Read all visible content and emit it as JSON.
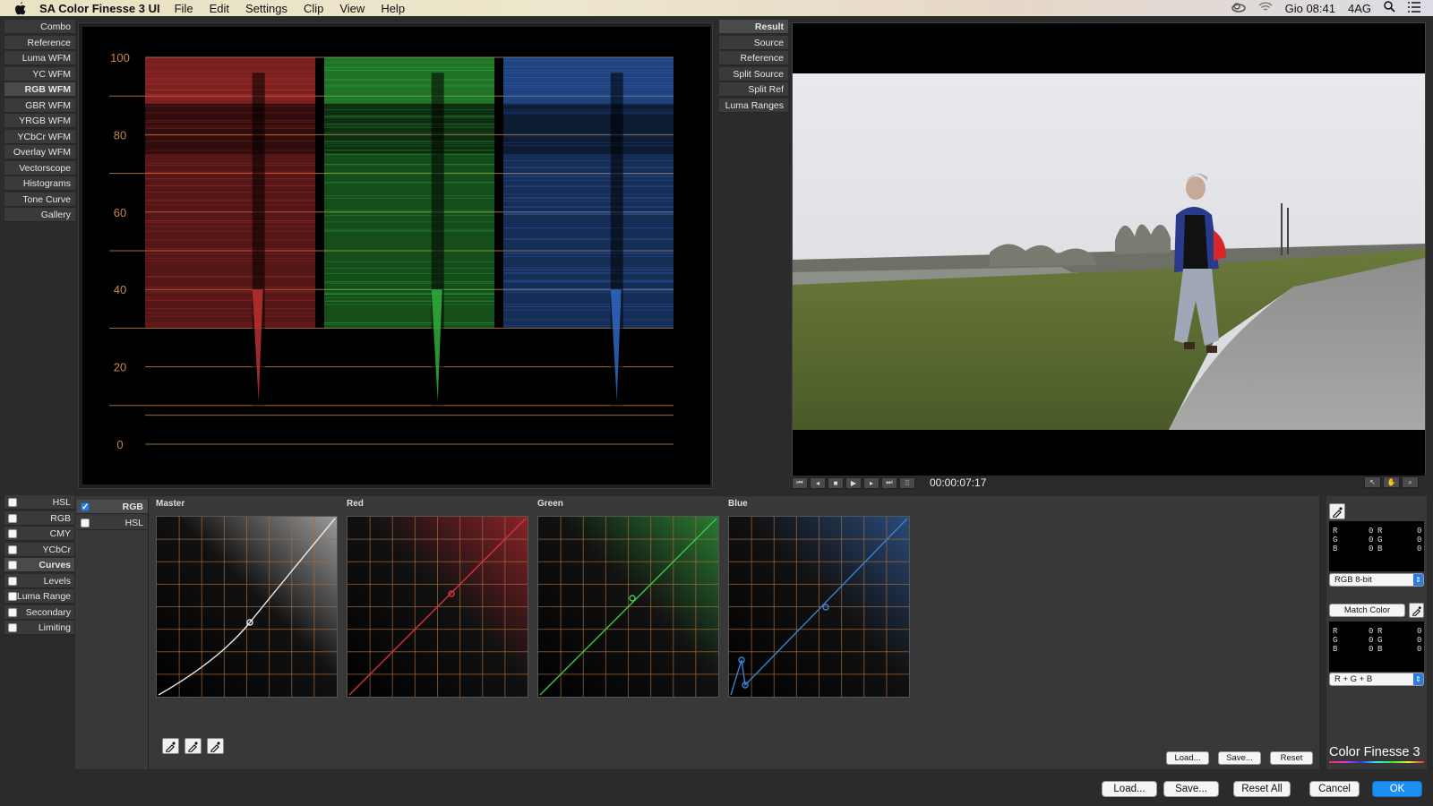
{
  "menubar": {
    "app_name": "SA Color Finesse 3 UI",
    "menus": [
      "File",
      "Edit",
      "Settings",
      "Clip",
      "View",
      "Help"
    ],
    "clock": "Gio 08:41",
    "user": "4AG"
  },
  "scope_tabs": [
    {
      "label": "Combo",
      "active": false
    },
    {
      "label": "Reference",
      "active": false
    },
    {
      "label": "Luma WFM",
      "active": false
    },
    {
      "label": "YC WFM",
      "active": false
    },
    {
      "label": "RGB WFM",
      "active": true
    },
    {
      "label": "GBR WFM",
      "active": false
    },
    {
      "label": "YRGB WFM",
      "active": false
    },
    {
      "label": "YCbCr WFM",
      "active": false
    },
    {
      "label": "Overlay WFM",
      "active": false
    },
    {
      "label": "Vectorscope",
      "active": false
    },
    {
      "label": "Histograms",
      "active": false
    },
    {
      "label": "Tone Curve",
      "active": false
    },
    {
      "label": "Gallery",
      "active": false
    }
  ],
  "waveform": {
    "y_ticks": [
      "100",
      "80",
      "60",
      "40",
      "20",
      "0"
    ],
    "channel_colors": [
      "#e03a3a",
      "#3ad24a",
      "#3a7ae8"
    ],
    "grid_color": "#c8864a"
  },
  "view_tabs": [
    {
      "label": "Result",
      "active": true
    },
    {
      "label": "Source",
      "active": false
    },
    {
      "label": "Reference",
      "active": false
    },
    {
      "label": "Split Source",
      "active": false
    },
    {
      "label": "Split Ref",
      "active": false
    },
    {
      "label": "Luma Ranges",
      "active": false
    }
  ],
  "transport": {
    "buttons": [
      "go-start-icon",
      "step-back-icon",
      "stop-icon",
      "play-icon",
      "step-forward-icon",
      "go-end-icon",
      "loop-icon"
    ],
    "timecode": "00:00:07:17",
    "tools": [
      "pointer-icon",
      "hand-icon",
      "zoom-icon"
    ]
  },
  "corrections": [
    {
      "label": "HSL",
      "checked": false
    },
    {
      "label": "RGB",
      "checked": false
    },
    {
      "label": "CMY",
      "checked": false
    },
    {
      "label": "YCbCr",
      "checked": false
    },
    {
      "label": "Curves",
      "checked": false
    },
    {
      "label": "Levels",
      "checked": false
    },
    {
      "label": "Luma Range",
      "checked": false
    },
    {
      "label": "Secondary",
      "checked": false
    },
    {
      "label": "Limiting",
      "checked": false
    }
  ],
  "curve_modes": [
    {
      "label": "RGB",
      "checked": true
    },
    {
      "label": "HSL",
      "checked": false
    }
  ],
  "curves": [
    {
      "label": "Master",
      "color": "#e8e8e8",
      "tint": "#9a9a9a"
    },
    {
      "label": "Red",
      "color": "#d8323c",
      "tint": "#8a2228"
    },
    {
      "label": "Green",
      "color": "#3cc84a",
      "tint": "#2a7a32"
    },
    {
      "label": "Blue",
      "color": "#3a82d0",
      "tint": "#2a4a7a"
    }
  ],
  "curve_buttons": {
    "load": "Load...",
    "save": "Save...",
    "reset": "Reset"
  },
  "readouts": [
    {
      "rows": [
        [
          "R",
          "0",
          "R",
          "0"
        ],
        [
          "G",
          "0",
          "G",
          "0"
        ],
        [
          "B",
          "0",
          "B",
          "0"
        ]
      ]
    },
    {
      "rows": [
        [
          "R",
          "0",
          "R",
          "0"
        ],
        [
          "G",
          "0",
          "G",
          "0"
        ],
        [
          "B",
          "0",
          "B",
          "0"
        ]
      ]
    }
  ],
  "right_panel": {
    "format": "RGB 8-bit",
    "match_label": "Match Color",
    "channels": "R + G + B",
    "logo": "Color Finesse 3"
  },
  "bottom_buttons": {
    "load": "Load...",
    "save": "Save...",
    "reset_all": "Reset All",
    "cancel": "Cancel",
    "ok": "OK"
  }
}
